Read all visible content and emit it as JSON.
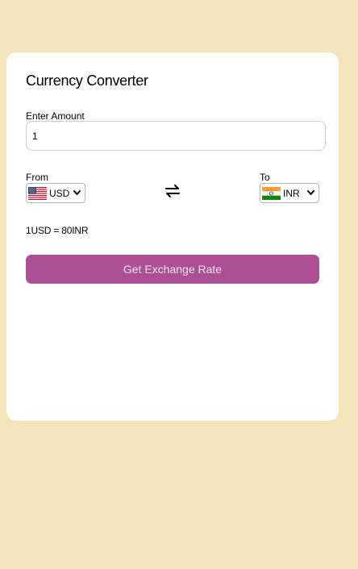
{
  "converter": {
    "title": "Currency Converter",
    "amount_label": "Enter Amount",
    "amount_value": "1",
    "from_label": "From",
    "from_currency": "USD",
    "to_label": "To",
    "to_currency": "INR",
    "rate_text": "1USD = 80INR",
    "button_label": "Get Exchange Rate"
  },
  "icons": {
    "from_flag": "us-flag-icon",
    "to_flag": "india-flag-icon",
    "swap": "swap-arrows-icon",
    "dropdown": "chevron-down-icon"
  },
  "colors": {
    "page_background": "#f3e4bb",
    "card_background": "#ffffff",
    "button_background": "#ad4f95",
    "button_text": "#f2e3f0"
  }
}
